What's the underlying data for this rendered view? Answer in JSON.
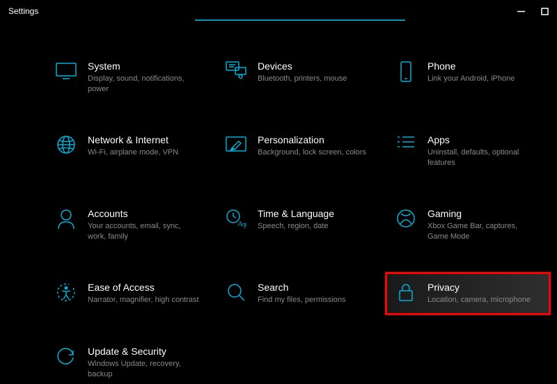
{
  "window": {
    "title": "Settings"
  },
  "accent_color": "#00b2d8",
  "highlight_color": "#ff0000",
  "categories": [
    {
      "key": "system",
      "title": "System",
      "desc": "Display, sound, notifications, power"
    },
    {
      "key": "devices",
      "title": "Devices",
      "desc": "Bluetooth, printers, mouse"
    },
    {
      "key": "phone",
      "title": "Phone",
      "desc": "Link your Android, iPhone"
    },
    {
      "key": "network",
      "title": "Network & Internet",
      "desc": "Wi-Fi, airplane mode, VPN"
    },
    {
      "key": "personalization",
      "title": "Personalization",
      "desc": "Background, lock screen, colors"
    },
    {
      "key": "apps",
      "title": "Apps",
      "desc": "Uninstall, defaults, optional features"
    },
    {
      "key": "accounts",
      "title": "Accounts",
      "desc": "Your accounts, email, sync, work, family"
    },
    {
      "key": "time",
      "title": "Time & Language",
      "desc": "Speech, region, date"
    },
    {
      "key": "gaming",
      "title": "Gaming",
      "desc": "Xbox Game Bar, captures, Game Mode"
    },
    {
      "key": "ease",
      "title": "Ease of Access",
      "desc": "Narrator, magnifier, high contrast"
    },
    {
      "key": "search",
      "title": "Search",
      "desc": "Find my files, permissions"
    },
    {
      "key": "privacy",
      "title": "Privacy",
      "desc": "Location, camera, microphone",
      "highlighted": true
    },
    {
      "key": "update",
      "title": "Update & Security",
      "desc": "Windows Update, recovery, backup"
    }
  ]
}
